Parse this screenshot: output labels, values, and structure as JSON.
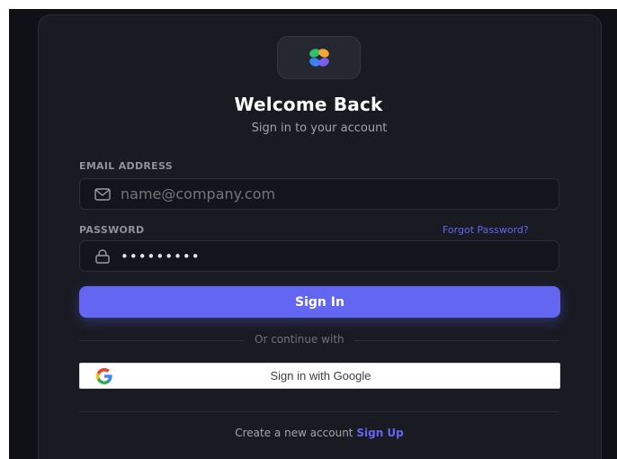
{
  "brand": {
    "logo_icon": "four-petal-logo-icon",
    "colors": {
      "green": "#2fbf71",
      "orange": "#f7a531",
      "blue": "#3b82f6",
      "violet": "#7c5cf0"
    }
  },
  "header": {
    "title": "Welcome Back",
    "subtitle": "Sign in to your account"
  },
  "form": {
    "email": {
      "label": "EMAIL ADDRESS",
      "placeholder": "name@company.com",
      "icon": "mail-icon"
    },
    "password": {
      "label": "PASSWORD",
      "value": "•••••••••",
      "icon": "lock-icon",
      "forgot_label": "Forgot Password?"
    },
    "submit_label": "Sign In"
  },
  "divider_text": "Or continue with",
  "google": {
    "label": "Sign in with Google",
    "icon": "google-g-icon"
  },
  "footer": {
    "prompt": "Create a new account",
    "link": "Sign Up"
  },
  "theme": {
    "accent": "#6366f1",
    "card_bg": "#191a22",
    "page_bg": "#101117"
  }
}
